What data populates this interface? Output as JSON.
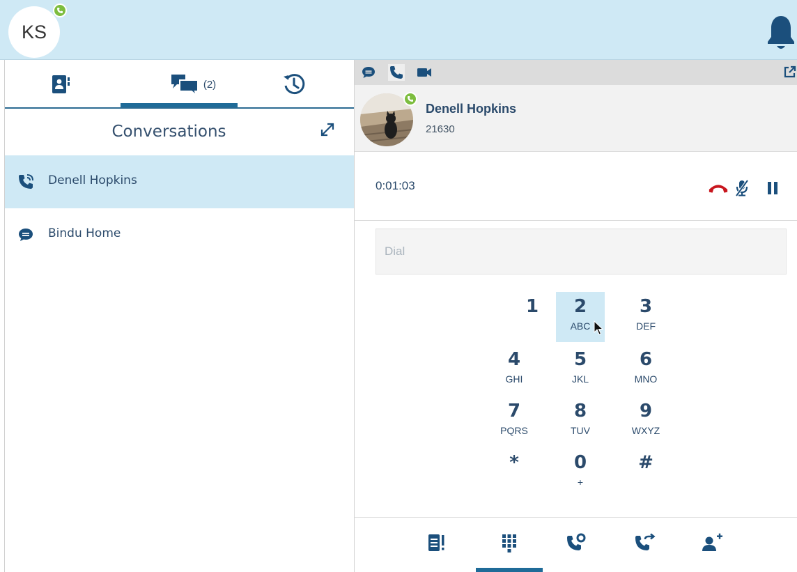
{
  "user": {
    "initials": "KS"
  },
  "left_tabs": {
    "chats_count": "(2)"
  },
  "conversations": {
    "title": "Conversations",
    "items": [
      {
        "label": "Denell Hopkins",
        "type": "call",
        "active": true
      },
      {
        "label": "Bindu Home",
        "type": "chat",
        "active": false
      }
    ]
  },
  "contact": {
    "name": "Denell Hopkins",
    "extension": "21630"
  },
  "call": {
    "timer": "0:01:03"
  },
  "dialer": {
    "placeholder": "Dial",
    "keys": [
      {
        "digit": "1",
        "letters": ""
      },
      {
        "digit": "2",
        "letters": "ABC"
      },
      {
        "digit": "3",
        "letters": "DEF"
      },
      {
        "digit": "4",
        "letters": "GHI"
      },
      {
        "digit": "5",
        "letters": "JKL"
      },
      {
        "digit": "6",
        "letters": "MNO"
      },
      {
        "digit": "7",
        "letters": "PQRS"
      },
      {
        "digit": "8",
        "letters": "TUV"
      },
      {
        "digit": "9",
        "letters": "WXYZ"
      },
      {
        "digit": "*",
        "letters": ""
      },
      {
        "digit": "0",
        "letters": "+"
      },
      {
        "digit": "#",
        "letters": ""
      }
    ]
  },
  "icons": {
    "top": [
      "status-phone-icon",
      "bell-icon"
    ],
    "left_tabs": [
      "contacts-icon",
      "chat-bubbles-icon",
      "history-icon"
    ],
    "modes": [
      "chat-mode-icon",
      "phone-mode-icon",
      "video-mode-icon"
    ],
    "call_controls": [
      "hangup-icon",
      "mute-icon",
      "pause-icon"
    ],
    "bottom": [
      "notes-icon",
      "keypad-icon",
      "voicemail-call-icon",
      "transfer-icon",
      "add-participant-icon"
    ]
  },
  "colors": {
    "header_bg": "#cfe9f5",
    "primary": "#1f4e79",
    "active_bar": "#1f6b98",
    "hangup": "#cc1f1f",
    "presence": "#7dbd3f"
  }
}
